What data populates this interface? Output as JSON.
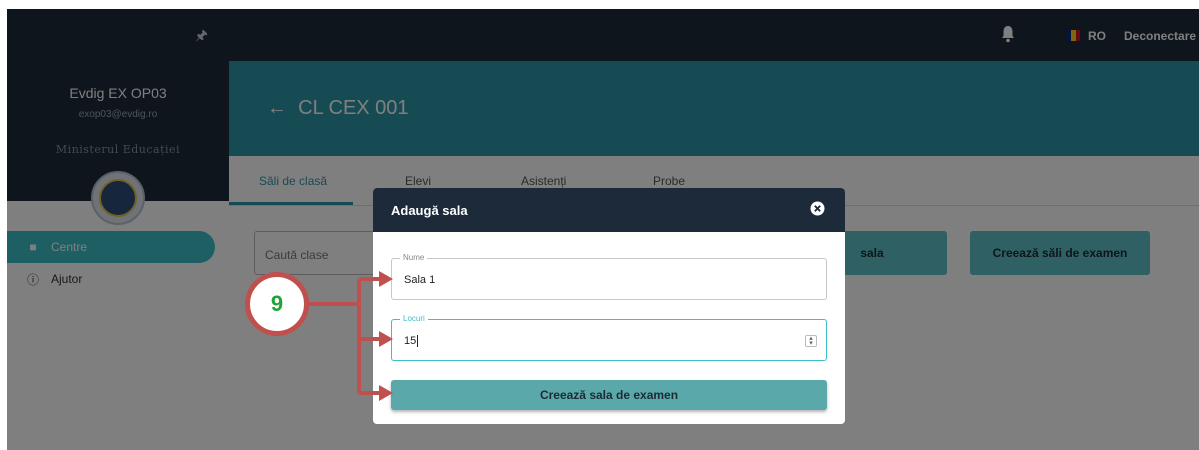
{
  "topbar": {
    "language": "RO",
    "logout_label": "Deconectare",
    "pin_icon": "pin-icon",
    "bell_icon": "bell-icon"
  },
  "sidebar": {
    "user_name": "Evdig EX OP03",
    "user_email": "exop03@evdig.ro",
    "ministry": "Ministerul Educației",
    "items": [
      {
        "label": "Centre",
        "icon": "building-icon",
        "active": true
      },
      {
        "label": "Ajutor",
        "icon": "help-icon",
        "active": false
      }
    ]
  },
  "main": {
    "title": "CL CEX 001",
    "tabs": [
      {
        "label": "Săli de clasă",
        "active": true
      },
      {
        "label": "Elevi"
      },
      {
        "label": "Asistenți"
      },
      {
        "label": "Probe"
      }
    ],
    "search_placeholder": "Caută clase",
    "add_room_partial": "sala",
    "create_rooms_label": "Creează săli de examen"
  },
  "modal": {
    "title": "Adaugă sala",
    "name_label": "Nume",
    "name_value": "Sala 1",
    "seats_label": "Locuri",
    "seats_value": "15",
    "submit_label": "Creează sala de examen"
  },
  "annotation": {
    "step": "9"
  },
  "colors": {
    "header": "#1c2a3a",
    "accent": "#3dbfc7",
    "banner": "#2e96a6",
    "annotation": "#c0504d",
    "step_text": "#22a33a"
  }
}
